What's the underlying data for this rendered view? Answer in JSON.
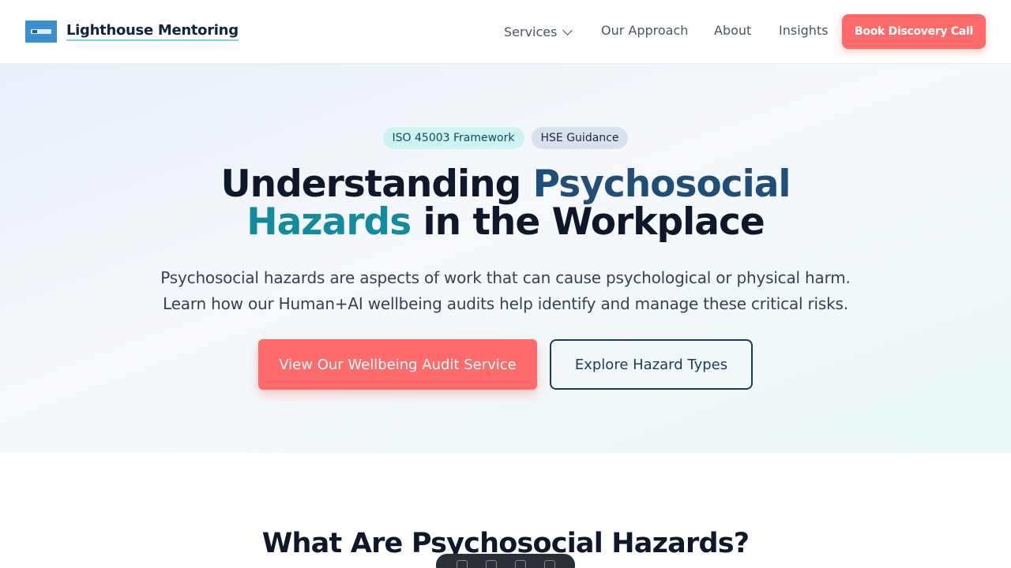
{
  "header": {
    "brand": "Lighthouse Mentoring",
    "logo_icon": "lighthouse-logo",
    "nav": {
      "services": "Services",
      "approach": "Our Approach",
      "about": "About",
      "insights": "Insights"
    },
    "cta": "Book Discovery Call"
  },
  "hero": {
    "badges": [
      "ISO 45003 Framework",
      "HSE Guidance"
    ],
    "title_part1": "Understanding ",
    "title_hl1": "Psychosocial",
    "title_hl2": "Hazards",
    "title_part2": " in the Workplace",
    "subtitle_line1": "Psychosocial hazards are aspects of work that can cause psychological or physical harm.",
    "subtitle_line2": "Learn how our Human+AI wellbeing audits help identify and manage these critical risks.",
    "primary_button": "View Our Wellbeing Audit Service",
    "secondary_button": "Explore Hazard Types"
  },
  "section": {
    "title": "What Are Psychosocial Hazards?"
  },
  "colors": {
    "accent": "#ff6b6b",
    "navy": "#1e3a5f",
    "teal": "#128c9c"
  }
}
